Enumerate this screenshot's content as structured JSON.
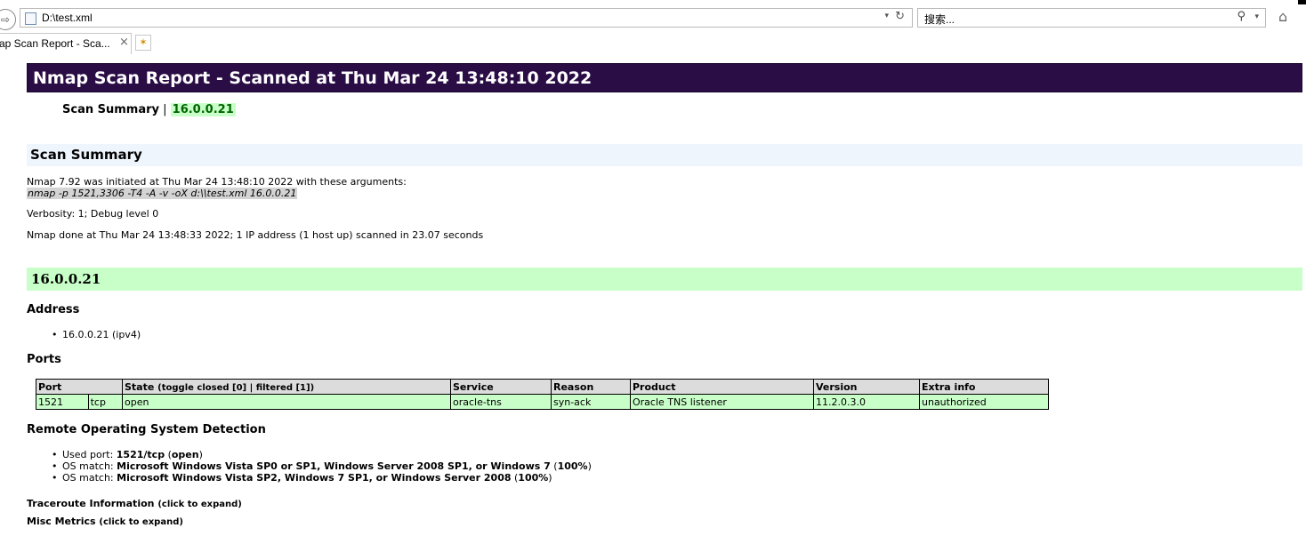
{
  "browser": {
    "address": "D:\\test.xml",
    "search_placeholder": "搜索...",
    "tab_title": "ap Scan Report - Sca...",
    "tab_close": "×",
    "nav_glyph": "⇨",
    "refresh_glyph": "↻",
    "dropdown_glyph": "▾",
    "search_glyph": "⚲",
    "home_glyph": "⌂",
    "new_tab_glyph": "✶"
  },
  "report": {
    "title": "Nmap Scan Report - Scanned at Thu Mar 24 13:48:10 2022",
    "nav": {
      "summary_link": "Scan Summary",
      "separator": " | ",
      "host_link": "16.0.0.21"
    }
  },
  "scan_summary": {
    "heading": "Scan Summary",
    "initiated": "Nmap 7.92 was initiated at Thu Mar 24 13:48:10 2022 with these arguments:",
    "arguments": "nmap -p 1521,3306 -T4 -A -v -oX d:\\\\test.xml 16.0.0.21",
    "verbosity": "Verbosity: 1; Debug level 0",
    "done": "Nmap done at Thu Mar 24 13:48:33 2022; 1 IP address (1 host up) scanned in 23.07 seconds"
  },
  "host": {
    "heading": "16.0.0.21",
    "address_heading": "Address",
    "addresses": [
      "16.0.0.21 (ipv4)"
    ],
    "ports_heading": "Ports",
    "ports_table": {
      "headers": {
        "port": "Port",
        "state": "State",
        "state_toggle": "(toggle closed [0] | filtered [1])",
        "service": "Service",
        "reason": "Reason",
        "product": "Product",
        "version": "Version",
        "extra": "Extra info"
      },
      "rows": [
        {
          "port": "1521",
          "proto": "tcp",
          "state": "open",
          "service": "oracle-tns",
          "reason": "syn-ack",
          "product": "Oracle TNS listener",
          "version": "11.2.0.3.0",
          "extra": "unauthorized"
        }
      ]
    },
    "os_heading": "Remote Operating System Detection",
    "os_items": {
      "used_port_prefix": "Used port: ",
      "used_port": "1521/tcp",
      "used_port_open_pre": " (",
      "used_port_state": "open",
      "used_port_open_post": ")",
      "match_prefix": "OS match: ",
      "match1_name": "Microsoft Windows Vista SP0 or SP1, Windows Server 2008 SP1, or Windows 7",
      "match1_pct_pre": " (",
      "match1_pct": "100%",
      "match1_pct_post": ")",
      "match2_name": "Microsoft Windows Vista SP2, Windows 7 SP1, or Windows Server 2008",
      "match2_pct_pre": " (",
      "match2_pct": "100%",
      "match2_pct_post": ")"
    },
    "traceroute": {
      "label": "Traceroute Information",
      "hint": "(click to expand)"
    },
    "misc": {
      "label": "Misc Metrics",
      "hint": "(click to expand)"
    }
  }
}
